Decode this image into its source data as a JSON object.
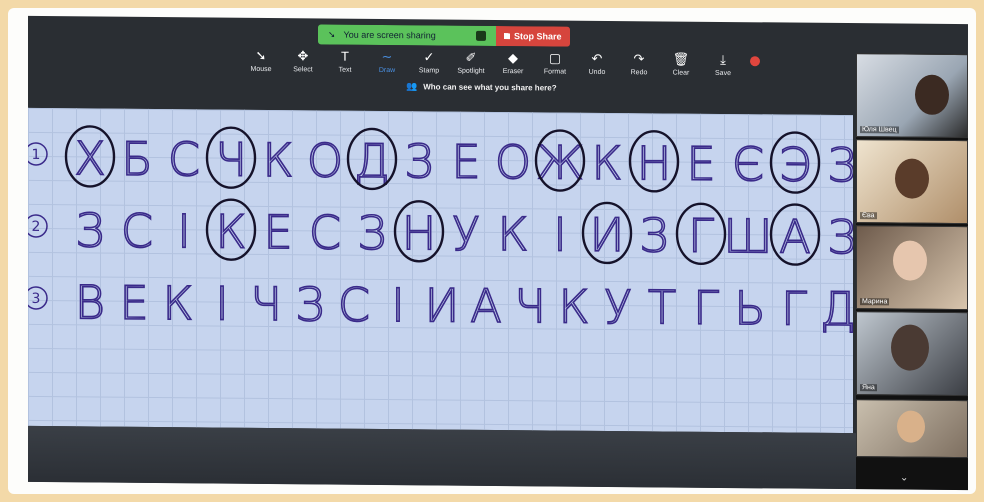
{
  "banner": {
    "sharing_text": "You are screen sharing",
    "stop_label": "Stop Share"
  },
  "toolbar": {
    "tools": [
      {
        "label": "Mouse",
        "icon": "mouse-pointer-icon",
        "glyph": "➘"
      },
      {
        "label": "Select",
        "icon": "move-icon",
        "glyph": "✥"
      },
      {
        "label": "Text",
        "icon": "text-icon",
        "glyph": "T"
      },
      {
        "label": "Draw",
        "icon": "draw-icon",
        "glyph": "∼",
        "active": true
      },
      {
        "label": "Stamp",
        "icon": "stamp-check-icon",
        "glyph": "✓"
      },
      {
        "label": "Spotlight",
        "icon": "spotlight-icon",
        "glyph": "✐"
      },
      {
        "label": "Eraser",
        "icon": "eraser-icon",
        "glyph": "◆"
      },
      {
        "label": "Format",
        "icon": "format-icon",
        "glyph": "▢"
      },
      {
        "label": "Undo",
        "icon": "undo-icon",
        "glyph": "↶"
      },
      {
        "label": "Redo",
        "icon": "redo-icon",
        "glyph": "↷"
      },
      {
        "label": "Clear",
        "icon": "trash-icon",
        "glyph": "🗑"
      },
      {
        "label": "Save",
        "icon": "save-icon",
        "glyph": "⤓"
      }
    ],
    "who_can_see": "Who can see what you share here?"
  },
  "board": {
    "rows": [
      {
        "num": "1",
        "letters": [
          "Х",
          "Б",
          "С",
          "Ч",
          "К",
          "О",
          "Д",
          "З",
          "Е",
          "О",
          "Ж",
          "К",
          "Н",
          "Е",
          "Є",
          "Э",
          "З"
        ],
        "circled": [
          0,
          3,
          6,
          10,
          12,
          15
        ]
      },
      {
        "num": "2",
        "letters": [
          "З",
          "С",
          "І",
          "К",
          "Е",
          "С",
          "З",
          "Н",
          "У",
          "К",
          "І",
          "И",
          "З",
          "Г",
          "Ш",
          "А",
          "З"
        ],
        "circled": [
          3,
          7,
          11,
          13,
          15
        ]
      },
      {
        "num": "3",
        "letters": [
          "В",
          "Е",
          "К",
          "І",
          "Ч",
          "З",
          "С",
          "І",
          "И",
          "А",
          "Ч",
          "К",
          "У",
          "Т",
          "Г",
          "Ь",
          "Г",
          "Д"
        ],
        "circled": []
      }
    ]
  },
  "participants": [
    {
      "name": "Юля Швец"
    },
    {
      "name": "Єва"
    },
    {
      "name": "Марина"
    },
    {
      "name": "Яна"
    },
    {
      "name": ""
    }
  ],
  "colors": {
    "ink": "#3a2a8a",
    "board": "#c6d4ee",
    "banner_green": "#5bc25b",
    "banner_red": "#d6453d"
  }
}
